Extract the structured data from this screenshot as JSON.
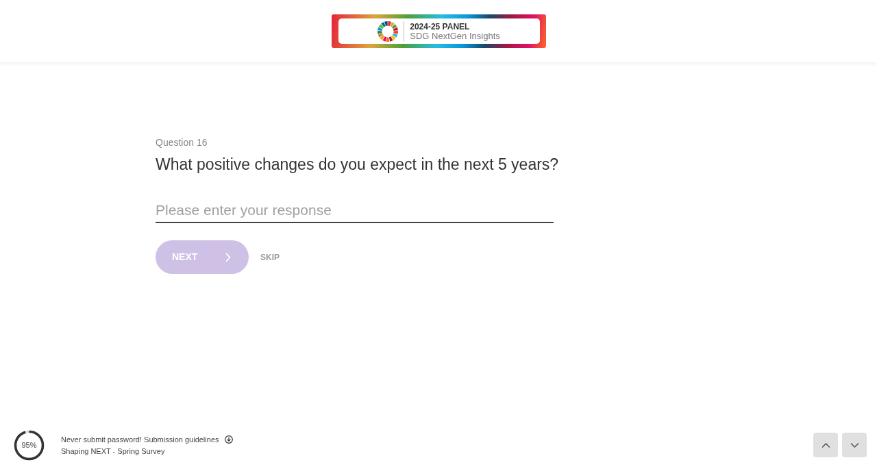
{
  "header": {
    "logo": {
      "line_1": "2024-25 PANEL",
      "line_2": "SDG NextGen Insights"
    }
  },
  "question": {
    "number_label": "Question 16",
    "text": "What positive changes do you expect in the next 5 years?",
    "response_field": {
      "placeholder": "Please enter your response"
    },
    "next_button": {
      "label": "NEXT",
      "disabled": true
    },
    "skip_link": "SKIP"
  },
  "footer": {
    "progress": {
      "level": 0.95,
      "reading": "95%"
    },
    "notice": "Never submit password! Submission guidelines",
    "survey_name": "Shaping NEXT - Spring Survey",
    "nav_buttons": [
      {
        "kind": "up"
      },
      {
        "kind": "down"
      }
    ]
  }
}
